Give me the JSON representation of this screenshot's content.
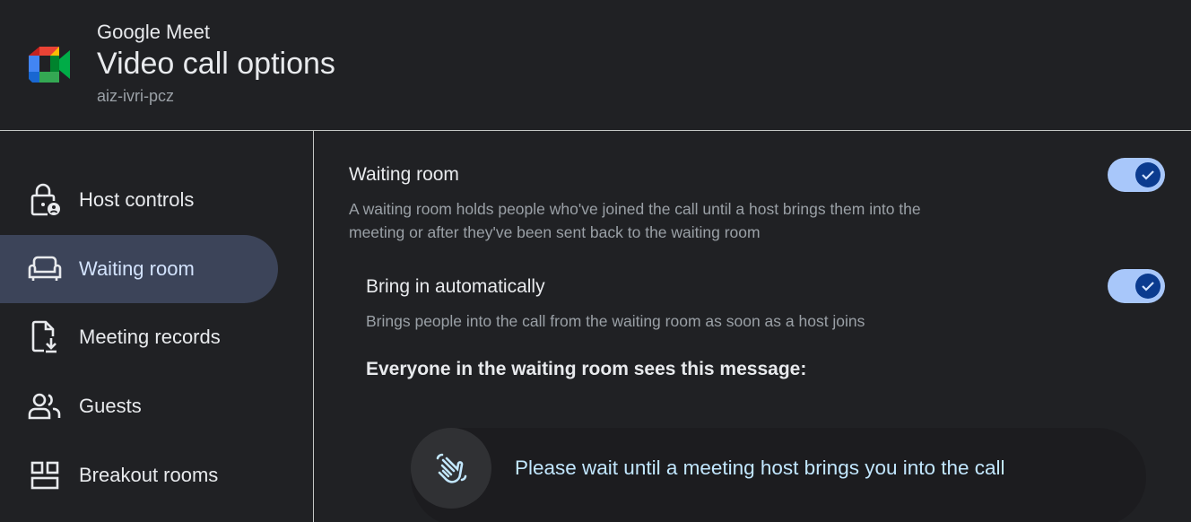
{
  "header": {
    "app_name": "Google Meet",
    "title": "Video call options",
    "meeting_code": "aiz-ivri-pcz",
    "logo_icon": "google-meet-logo"
  },
  "sidebar": {
    "items": [
      {
        "label": "Host controls",
        "icon": "lock-person-icon",
        "active": false
      },
      {
        "label": "Waiting room",
        "icon": "chair-icon",
        "active": true
      },
      {
        "label": "Meeting records",
        "icon": "file-download-icon",
        "active": false
      },
      {
        "label": "Guests",
        "icon": "people-icon",
        "active": false
      },
      {
        "label": "Breakout rooms",
        "icon": "grid-icon",
        "active": false
      }
    ]
  },
  "main": {
    "waiting_room": {
      "title": "Waiting room",
      "description_line1": "A waiting room holds people who've joined the call until a host brings them into the",
      "description_line2": "meeting or after they've been sent back to the waiting room",
      "enabled": true
    },
    "bring_in": {
      "title": "Bring in automatically",
      "description": "Brings people into the call from the waiting room as soon as a host joins",
      "enabled": true
    },
    "message_heading": "Everyone in the waiting room sees this message:",
    "message_text": "Please wait until a meeting host brings you into the call",
    "message_icon": "waving-hand-icon"
  },
  "colors": {
    "background": "#202124",
    "active_nav": "#3c4459",
    "toggle_track": "#a8c7fa",
    "toggle_knob": "#0b3b8f",
    "message_text": "#c2e7ff"
  }
}
